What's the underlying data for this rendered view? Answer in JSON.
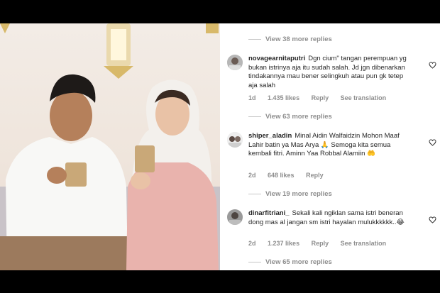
{
  "view_more_labels": [
    "View 38 more replies",
    "View 63 more replies",
    "View 19 more replies",
    "View 65 more replies"
  ],
  "comments": [
    {
      "username": "novagearnitaputri",
      "text": "Dgn cium\" tangan perempuan yg bukan istrinya aja itu sudah salah. Jd jgn dibenarkan tindakannya mau bener selingkuh atau pun gk tetep aja salah",
      "time": "1d",
      "likes": "1.435 likes",
      "reply": "Reply",
      "translate": "See translation"
    },
    {
      "username": "shiper_aladin",
      "text": "Minal Aidin Walfaidzin Mohon Maaf Lahir batin ya Mas Arya 🙏 Semoga kita semua kembali fitri. Aminn Yaa Robbal Alamiin 🤲",
      "time": "2d",
      "likes": "648 likes",
      "reply": "Reply",
      "translate": ""
    },
    {
      "username": "dinarfitriani_",
      "text": "Sekali kali ngiklan sama istri beneran dong mas al jangan sm istri hayalan mulukkkkkk..😂",
      "time": "2d",
      "likes": "1.237 likes",
      "reply": "Reply",
      "translate": "See translation"
    }
  ],
  "colors": {
    "meta_gray": "#8e8e8e",
    "text": "#262626",
    "background": "#ffffff"
  },
  "icons": [
    "heart-icon"
  ]
}
